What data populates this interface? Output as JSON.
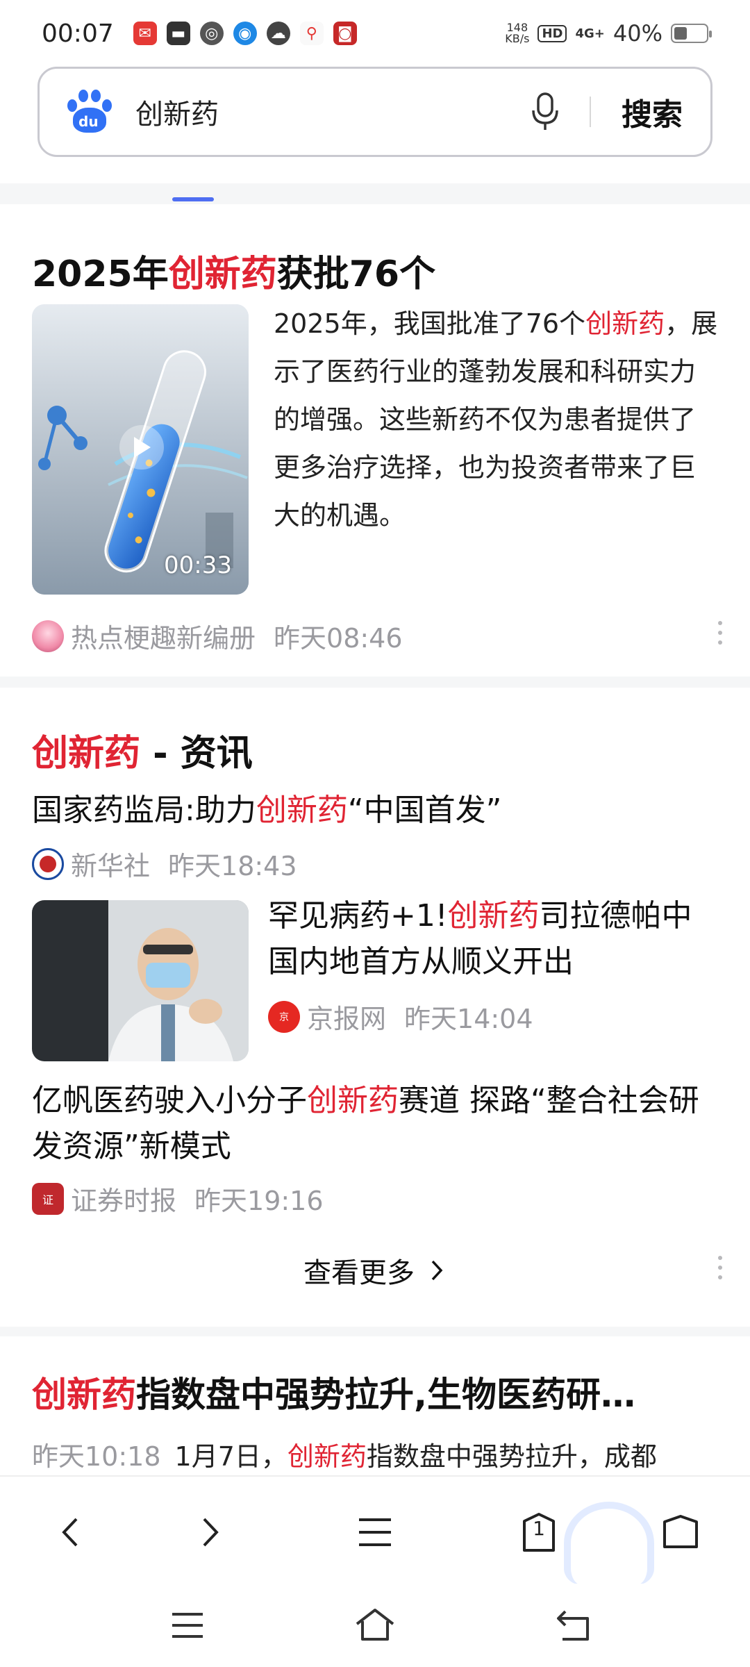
{
  "status_bar": {
    "time": "00:07",
    "net_speed_value": "148",
    "net_speed_unit": "KB/s",
    "hd": "HD",
    "network": "4G+",
    "battery": "40%",
    "battery_level": 0.4
  },
  "search": {
    "query": "创新药",
    "button": "搜索"
  },
  "result1": {
    "title_pre": "2025年",
    "title_hl": "创新药",
    "title_post": "获批76个",
    "video_duration": "00:33",
    "desc_pre": "2025年，我国批准了76个",
    "desc_hl": "创新药",
    "desc_post": "，展示了医药行业的蓬勃发展和科研实力的增强。这些新药不仅为患者提供了更多治疗选择，也为投资者带来了巨大的机遇。",
    "source": "热点梗趣新编册",
    "time": "昨天08:46"
  },
  "news": {
    "heading_hl": "创新药",
    "heading_post": " - 资讯",
    "items": [
      {
        "pre": "国家药监局:助力",
        "hl": "创新药",
        "post": "“中国首发”",
        "source": "新华社",
        "time": "昨天18:43"
      },
      {
        "pre": "罕见病药+1!",
        "hl": "创新药",
        "post": "司拉德帕中国内地首方从顺义开出",
        "source": "京报网",
        "time": "昨天14:04"
      },
      {
        "pre": "亿帆医药驶入小分子",
        "hl": "创新药",
        "post": "赛道 探路“整合社会研发资源”新模式",
        "source": "证券时报",
        "time": "昨天19:16"
      }
    ],
    "more": "查看更多"
  },
  "result3": {
    "title_hl": "创新药",
    "title_post": "指数盘中强势拉升,生物医药研…",
    "time": "昨天10:18",
    "snippet_pre": "1月7日，",
    "snippet_hl": "创新药",
    "snippet_post": "指数盘中强势拉升，成都"
  },
  "bottom_nav": {
    "tabs_count": "1"
  },
  "colors": {
    "highlight": "#e02433",
    "brand": "#3171f5",
    "indicator": "#4e6ef2"
  }
}
